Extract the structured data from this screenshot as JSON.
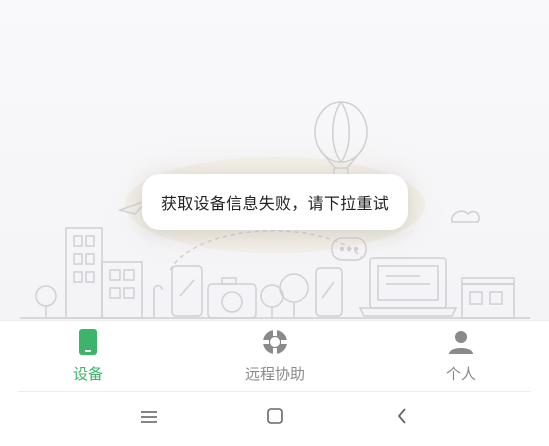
{
  "toast": {
    "message": "获取设备信息失败，请下拉重试"
  },
  "tabs": [
    {
      "label": "设备",
      "icon": "phone-icon",
      "active": true
    },
    {
      "label": "远程协助",
      "icon": "lifebuoy-icon",
      "active": false
    },
    {
      "label": "个人",
      "icon": "person-icon",
      "active": false
    }
  ],
  "colors": {
    "accent": "#3cb46a",
    "inactive": "#8a8a8a",
    "line_art": "#cfcfd4",
    "background": "#f6f6f9"
  },
  "system_nav": {
    "menu_icon": "menu-icon",
    "home_icon": "home-square-icon",
    "back_icon": "back-chevron-icon"
  }
}
